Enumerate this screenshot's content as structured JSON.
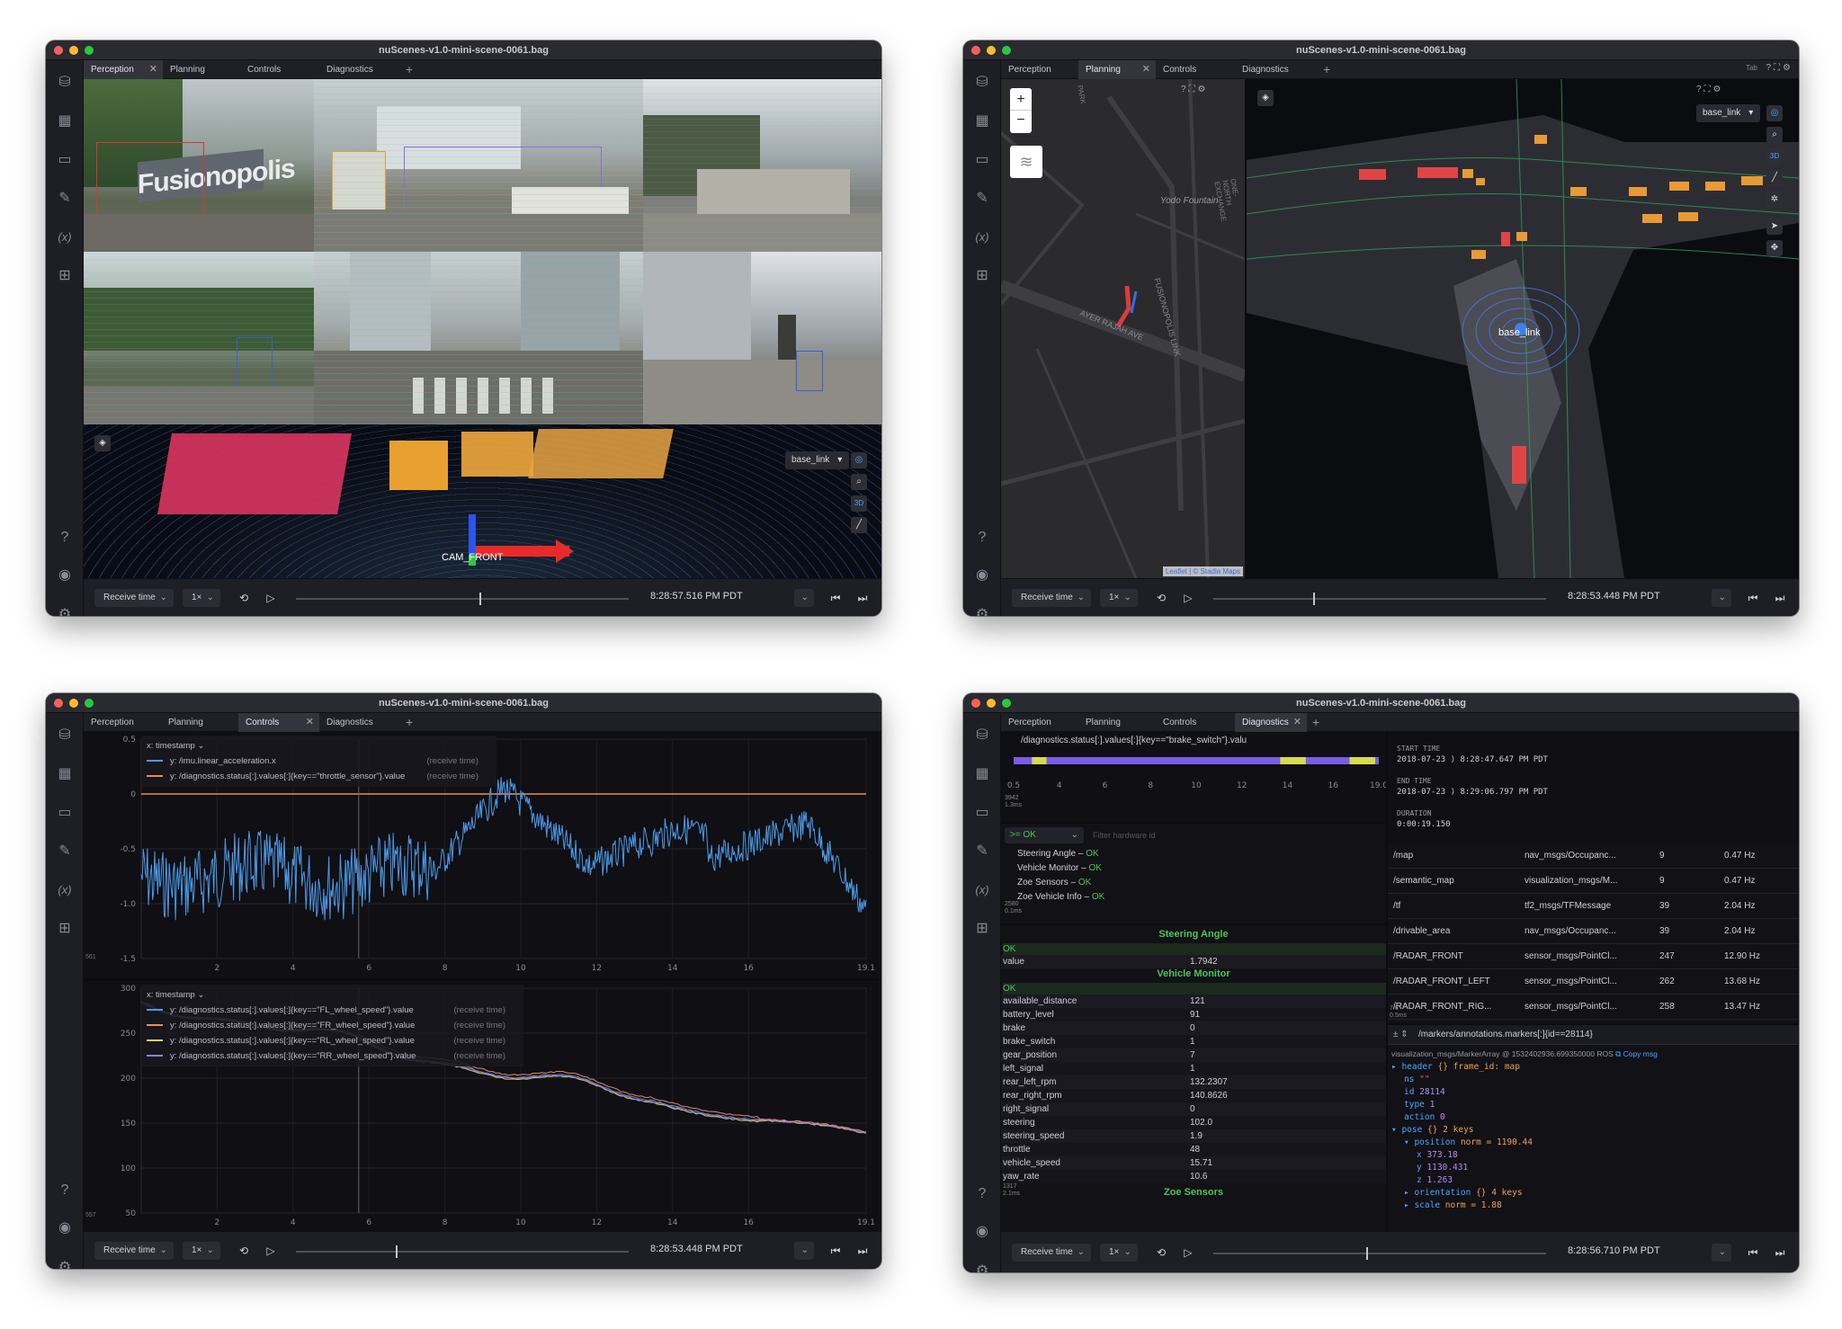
{
  "window_title": "nuScenes-v1.0-mini-scene-0061.bag",
  "tabs": {
    "perception": "Perception",
    "planning": "Planning",
    "controls": "Controls",
    "diagnostics": "Diagnostics",
    "add": "+",
    "close": "✕"
  },
  "playback": {
    "mode": "Receive time",
    "speed": "1×",
    "time_tl": "8:28:57.516 PM PDT",
    "time_tr": "8:28:53.448 PM PDT",
    "time_bl": "8:28:53.448 PM PDT",
    "time_br": "8:28:56.710 PM PDT",
    "progress_tl": 0.55,
    "progress_tr": 0.3,
    "progress_bl": 0.3,
    "progress_br": 0.46
  },
  "perception": {
    "camera_label": "CAM_FRONT",
    "frame": "base_link",
    "sign_text": "Fusionopolis"
  },
  "planning": {
    "tab_label": "Tab",
    "frame": "base_link",
    "vehicle_label": "base_link",
    "map_labels": [
      "Yodo Fountain",
      "FUSIONOPOLIS LINK",
      "AYER RAJAH AVE",
      "ONE-NORTH EXCHANGE",
      "PARK"
    ],
    "attribution": "Leaflet | © Stadia Maps",
    "zoom_in": "+",
    "zoom_out": "−"
  },
  "controls": {
    "plot1": {
      "x_label": "x: timestamp",
      "series": [
        {
          "name": "y: /imu.linear_acceleration.x",
          "color": "#4c9be8",
          "note": "(receive time)"
        },
        {
          "name": "y: /diagnostics.status[:].values[:]{key==\"throttle_sensor\"}.value",
          "color": "#f08a5d",
          "note": "(receive time)"
        }
      ],
      "yticks": [
        "0.5",
        "0",
        "-0.5",
        "-1.0",
        "-1.5"
      ],
      "xticks": [
        "2",
        "4",
        "6",
        "8",
        "10",
        "12",
        "14",
        "16",
        "19.1"
      ],
      "corner": "561\n0.8ms"
    },
    "plot2": {
      "x_label": "x: timestamp",
      "series": [
        {
          "name": "y: /diagnostics.status[:].values[:]{key==\"FL_wheel_speed\"}.value",
          "color": "#4c9be8",
          "note": "(receive time)"
        },
        {
          "name": "y: /diagnostics.status[:].values[:]{key==\"FR_wheel_speed\"}.value",
          "color": "#f08a5d",
          "note": "(receive time)"
        },
        {
          "name": "y: /diagnostics.status[:].values[:]{key==\"RL_wheel_speed\"}.value",
          "color": "#e8d44c",
          "note": "(receive time)"
        },
        {
          "name": "y: /diagnostics.status[:].values[:]{key==\"RR_wheel_speed\"}.value",
          "color": "#9b7be8",
          "note": "(receive time)"
        }
      ],
      "yticks": [
        "300",
        "250",
        "200",
        "150",
        "100",
        "50"
      ],
      "xticks": [
        "2",
        "4",
        "6",
        "8",
        "10",
        "12",
        "14",
        "16",
        "19.1"
      ],
      "corner": "557\n1.4ms"
    }
  },
  "diagnostics": {
    "state_plot_title": "/diagnostics.status[:].values[:]{key==\"brake_switch\"}.valu",
    "state_xticks": [
      "0.5",
      "4",
      "6",
      "8",
      "10",
      "12",
      "14",
      "16",
      "19.0"
    ],
    "state_corner": "3942\n1.3ms",
    "filter_value": ">= OK",
    "filter_placeholder": "Filter hardware id",
    "status_list": [
      {
        "name": "Steering Angle",
        "level": "OK"
      },
      {
        "name": "Vehicle Monitor",
        "level": "OK"
      },
      {
        "name": "Zoe Sensors",
        "level": "OK"
      },
      {
        "name": "Zoe Vehicle Info",
        "level": "OK"
      }
    ],
    "list_corner": "2580\n0.1ms",
    "steering_angle": {
      "title": "Steering Angle",
      "status": "OK",
      "rows": [
        [
          "value",
          "1.7942"
        ]
      ]
    },
    "vehicle_monitor": {
      "title": "Vehicle Monitor",
      "status": "OK",
      "rows": [
        [
          "available_distance",
          "121"
        ],
        [
          "battery_level",
          "91"
        ],
        [
          "brake",
          "0"
        ],
        [
          "brake_switch",
          "1"
        ],
        [
          "gear_position",
          "7"
        ],
        [
          "left_signal",
          "1"
        ],
        [
          "rear_left_rpm",
          "132.2307"
        ],
        [
          "rear_right_rpm",
          "140.8626"
        ],
        [
          "right_signal",
          "0"
        ],
        [
          "steering",
          "102.0"
        ],
        [
          "steering_speed",
          "1.9"
        ],
        [
          "throttle",
          "48"
        ],
        [
          "vehicle_speed",
          "15.71"
        ],
        [
          "yaw_rate",
          "10.6"
        ]
      ]
    },
    "zoe_sensors_title": "Zoe Sensors",
    "detail_corner": "1317\n2.1ms",
    "info": {
      "start_label": "START TIME",
      "start": "2018-07-23 ⟩ 8:28:47.647 PM PDT",
      "end_label": "END TIME",
      "end": "2018-07-23 ⟩ 8:29:06.797 PM PDT",
      "dur_label": "DURATION",
      "dur": "0:00:19.150"
    },
    "topics": [
      [
        "/map",
        "nav_msgs/Occupanc...",
        "9",
        "0.47 Hz"
      ],
      [
        "/semantic_map",
        "visualization_msgs/M...",
        "9",
        "0.47 Hz"
      ],
      [
        "/tf",
        "tf2_msgs/TFMessage",
        "39",
        "2.04 Hz"
      ],
      [
        "/drivable_area",
        "nav_msgs/Occupanc...",
        "39",
        "2.04 Hz"
      ],
      [
        "/RADAR_FRONT",
        "sensor_msgs/PointCl...",
        "247",
        "12.90 Hz"
      ],
      [
        "/RADAR_FRONT_LEFT",
        "sensor_msgs/PointCl...",
        "262",
        "13.68 Hz"
      ],
      [
        "/RADAR_FRONT_RIG...",
        "sensor_msgs/PointCl...",
        "258",
        "13.47 Hz"
      ]
    ],
    "topics_corner": "7.6\n0.5ms",
    "raw_path": "/markers/annotations.markers[:]{id==28114}",
    "raw_meta": "visualization_msgs/MarkerArray @ 1532402936.699350000 ROS",
    "copy_label": "Copy msg",
    "raw_lines": [
      [
        "▸ header",
        "{} frame_id: map"
      ],
      [
        "ns",
        "\"\""
      ],
      [
        "id",
        "28114"
      ],
      [
        "type",
        "1"
      ],
      [
        "action",
        "0"
      ],
      [
        "▾ pose",
        "{} 2 keys"
      ],
      [
        "▾ position",
        "norm = 1190.44"
      ],
      [
        "x",
        "373.18"
      ],
      [
        "y",
        "1130.431"
      ],
      [
        "z",
        "1.263"
      ],
      [
        "▸ orientation",
        "{} 4 keys"
      ],
      [
        "▸ scale",
        "norm = 1.88"
      ]
    ],
    "raw_corner": "738\n1.4ms"
  }
}
